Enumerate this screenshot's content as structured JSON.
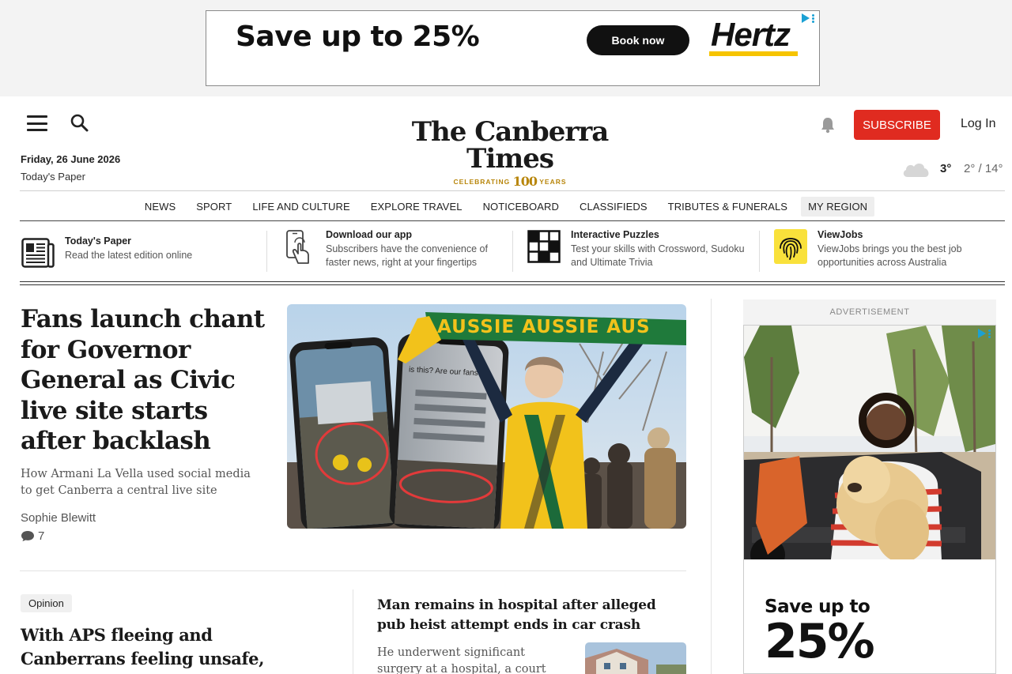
{
  "top_ad": {
    "headline": "Save up to 25%",
    "cta": "Book now",
    "brand": "Hertz",
    "brand_mark": "®"
  },
  "header": {
    "date": "Friday, 26 June 2026",
    "todays_paper": "Today's Paper",
    "logo_name": "The Canberra Times",
    "logo_tagline": "CELEBRATING",
    "logo_number": "100",
    "logo_years": "YEARS",
    "subscribe_label": "SUBSCRIBE",
    "login_label": "Log In",
    "weather": {
      "current": "3°",
      "range": "2° / 14°"
    }
  },
  "nav": {
    "items": [
      "NEWS",
      "SPORT",
      "LIFE AND CULTURE",
      "EXPLORE TRAVEL",
      "NOTICEBOARD",
      "CLASSIFIEDS",
      "TRIBUTES & FUNERALS",
      "MY REGION"
    ],
    "active": "MY REGION"
  },
  "promos": [
    {
      "title": "Today's Paper",
      "desc": "Read the latest edition online",
      "icon": "newspaper-icon"
    },
    {
      "title": "Download our app",
      "desc": "Subscribers have the convenience of faster news, right at your fingertips",
      "icon": "phone-tap-icon"
    },
    {
      "title": "Interactive Puzzles",
      "desc": "Test your skills with Crossword, Sudoku and Ultimate Trivia",
      "icon": "crossword-icon"
    },
    {
      "title": "ViewJobs",
      "desc": "ViewJobs brings you the best job opportunities across Australia",
      "icon": "fingerprint-icon"
    }
  ],
  "lead_story": {
    "headline": "Fans launch chant for Governor General as Civic live site starts after backlash",
    "summary": "How Armani La Vella used social media to get Canberra a central live site",
    "author": "Sophie Blewitt",
    "comments": "7",
    "image_scarf_text": "AUSSIE AUSSIE AUS",
    "image_phone_text": "is this? Are our fans?"
  },
  "opinion_story": {
    "tag": "Opinion",
    "headline": "With APS fleeing and Canberrans feeling unsafe, here's my plan to"
  },
  "second_story": {
    "headline": "Man remains in hospital after alleged pub heist attempt ends in car crash",
    "summary": "He underwent significant surgery at a hospital, a court"
  },
  "side_ad": {
    "label": "ADVERTISEMENT",
    "line1": "Save up to",
    "line2": "25%"
  },
  "colors": {
    "subscribe": "#e02b20",
    "hertz_yellow": "#f6c400",
    "logo_gold": "#b8860b",
    "adchoice_blue": "#1ba1d4"
  }
}
